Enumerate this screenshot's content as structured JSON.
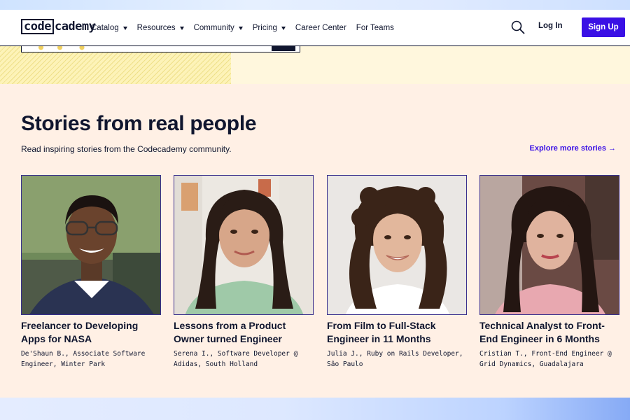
{
  "header": {
    "logo": {
      "boxed": "code",
      "rest": "cademy"
    },
    "nav": [
      {
        "label": "Catalog",
        "dropdown": true
      },
      {
        "label": "Resources",
        "dropdown": true
      },
      {
        "label": "Community",
        "dropdown": true
      },
      {
        "label": "Pricing",
        "dropdown": true
      },
      {
        "label": "Career Center",
        "dropdown": false
      },
      {
        "label": "For Teams",
        "dropdown": false
      }
    ],
    "search_icon": "search-icon",
    "login_label": "Log In",
    "signup_label": "Sign Up"
  },
  "colors": {
    "brand_blue": "#3a10e5",
    "navy": "#10162f",
    "section_bg": "#fff0e5"
  },
  "stories": {
    "title": "Stories from real people",
    "subtitle": "Read inspiring stories from the Codecademy community.",
    "explore_label": "Explore more stories →",
    "cards": [
      {
        "title": "Freelancer to Developing Apps for NASA",
        "meta": "De'Shaun B., Associate Software Engineer, Winter Park"
      },
      {
        "title": "Lessons from a Product Owner turned Engineer",
        "meta": "Serena I., Software Developer @ Adidas, South Holland"
      },
      {
        "title": "From Film to Full-Stack Engineer in 11 Months",
        "meta": "Julia J., Ruby on Rails Developer, São Paulo"
      },
      {
        "title": "Technical Analyst to Front-End Engineer in 6 Months",
        "meta": "Cristian T., Front-End Engineer @ Grid Dynamics, Guadalajara"
      }
    ]
  }
}
